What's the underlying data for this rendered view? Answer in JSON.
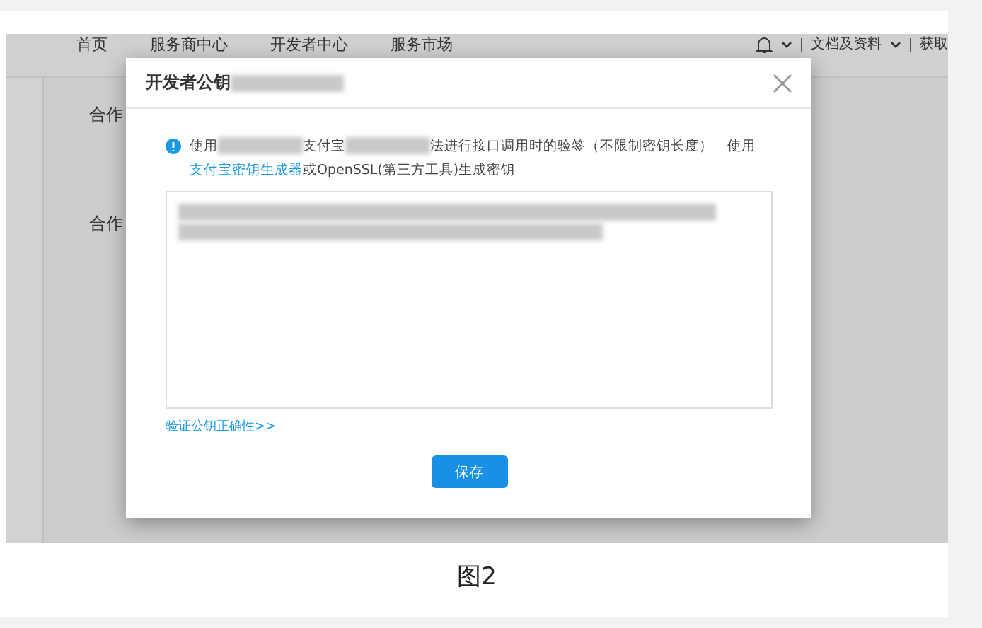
{
  "nav": {
    "items": [
      {
        "label": "首页"
      },
      {
        "label": "服务商中心"
      },
      {
        "label": "开发者中心"
      },
      {
        "label": "服务市场"
      }
    ],
    "right": [
      {
        "kind": "bell"
      },
      {
        "kind": "chevron"
      },
      {
        "kind": "divider"
      },
      {
        "kind": "text",
        "label": "文档及资料"
      },
      {
        "kind": "chevron"
      },
      {
        "kind": "divider"
      },
      {
        "kind": "text",
        "label": "获取"
      }
    ]
  },
  "background": {
    "headings": [
      "合作",
      "合作"
    ]
  },
  "dialog": {
    "title": "开发者公钥",
    "title_redacted": true,
    "info": [
      {
        "kind": "text",
        "text": "使用"
      },
      {
        "kind": "redacted"
      },
      {
        "kind": "text",
        "text": "支付宝"
      },
      {
        "kind": "redacted"
      },
      {
        "kind": "text",
        "text": "法进行接口调用时的验签（不限制密钥长度）。使用"
      },
      {
        "kind": "link",
        "text": "支付宝密钥生成器"
      },
      {
        "kind": "text",
        "text": "或OpenSSL(第三方工具)生成密钥"
      }
    ],
    "verify_link": "验证公钥正确性>>",
    "save_button": "保存"
  },
  "caption": "图2"
}
